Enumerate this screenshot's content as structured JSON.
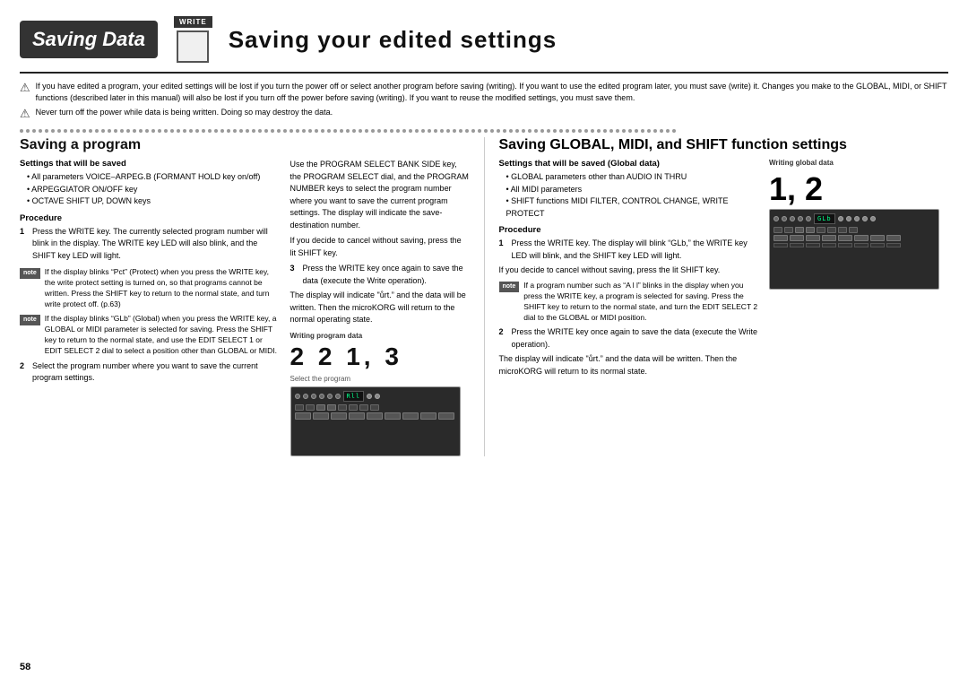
{
  "header": {
    "badge_text": "Saving Data",
    "write_label": "WRITE",
    "main_title": "Saving your edited settings"
  },
  "warnings": [
    {
      "id": "w1",
      "text": "If you have edited a program, your edited settings will be lost if you turn the power off or select another program before saving (writing). If you want to use the edited program later, you must save (write) it. Changes you make to the GLOBAL, MIDI, or SHIFT functions (described later in this manual) will also be lost if you turn off the power before saving (writing). If you want to reuse the modified settings, you must save them."
    },
    {
      "id": "w2",
      "text": "Never turn off the power while data is being written. Doing so may destroy the data."
    }
  ],
  "left_section": {
    "title": "Saving a program",
    "settings_title": "Settings that will be saved",
    "settings_bullets": [
      "All parameters VOICE–ARPEG.B (FORMANT HOLD key on/off)",
      "ARPEGGIATOR ON/OFF key",
      "OCTAVE SHIFT UP, DOWN keys"
    ],
    "procedure_title": "Procedure",
    "steps": [
      {
        "num": "1",
        "text": "Press the WRITE key. The currently selected program number will blink in the display. The WRITE key LED will also blink, and the SHIFT key LED will light."
      },
      {
        "num": "2",
        "text": "Select the program number where you want to save the current program settings."
      }
    ],
    "note1": {
      "label": "note",
      "text": "If the display blinks “Pct” (Protect) when you press the WRITE key, the write protect setting is turned on, so that programs cannot be written. Press the SHIFT key to return to the normal state, and turn write protect off. (p.63)"
    },
    "note2": {
      "label": "note",
      "text": "If the display blinks “GLb” (Global) when you press the WRITE key, a GLOBAL or MIDI parameter is selected for saving. Press the SHIFT key to return to the normal state, and use the EDIT SELECT 1 or EDIT SELECT 2 dial to select a position other than GLOBAL or MIDI."
    },
    "middle_text": "Use the PROGRAM SELECT BANK SIDE key, the PROGRAM SELECT dial, and the PROGRAM NUMBER keys to select the program number where you want to save the current program settings. The display will indicate the save-destination number.",
    "cancel_text": "If you decide to cancel without saving, press the lit SHIFT key.",
    "step3": {
      "num": "3",
      "text": "Press the WRITE key once again to save the data (execute the Write operation)."
    },
    "display_text1": "The display will indicate \"ůrt.” and the data will be written. Then the microKORG will return to the normal operating state.",
    "writing_label": "Writing program data",
    "large_nums": "2   2   1, 3",
    "select_program": "Select the program"
  },
  "right_section": {
    "title": "Saving GLOBAL, MIDI, and SHIFT function settings",
    "settings_title": "Settings that will be saved (Global data)",
    "settings_bullets": [
      "GLOBAL parameters other than AUDIO IN THRU",
      "All MIDI parameters",
      "SHIFT functions MIDI FILTER, CONTROL CHANGE, WRITE PROTECT"
    ],
    "procedure_title": "Procedure",
    "writing_global_label": "Writing global data",
    "large_nums": "1, 2",
    "glb_text": "GLb",
    "steps": [
      {
        "num": "1",
        "text": "Press the WRITE key. The display will blink “GLb,” the WRITE key LED will blink, and the SHIFT key LED will light."
      },
      {
        "num": "2",
        "text": "Press the WRITE key once again to save the data (execute the Write operation)."
      }
    ],
    "cancel_text": "If you decide to cancel without saving, press the lit SHIFT key.",
    "note1": {
      "label": "note",
      "text": "If a program number such as “A l l” blinks in the display when you press the WRITE key, a program is selected for saving. Press the SHIFT key to return to the normal state, and turn the EDIT SELECT 2 dial to the GLOBAL or MIDI position."
    },
    "display_text": "The display will indicate \"ůrt.” and the data will be written. Then the microKORG will return to its normal state."
  },
  "page_num": "58"
}
